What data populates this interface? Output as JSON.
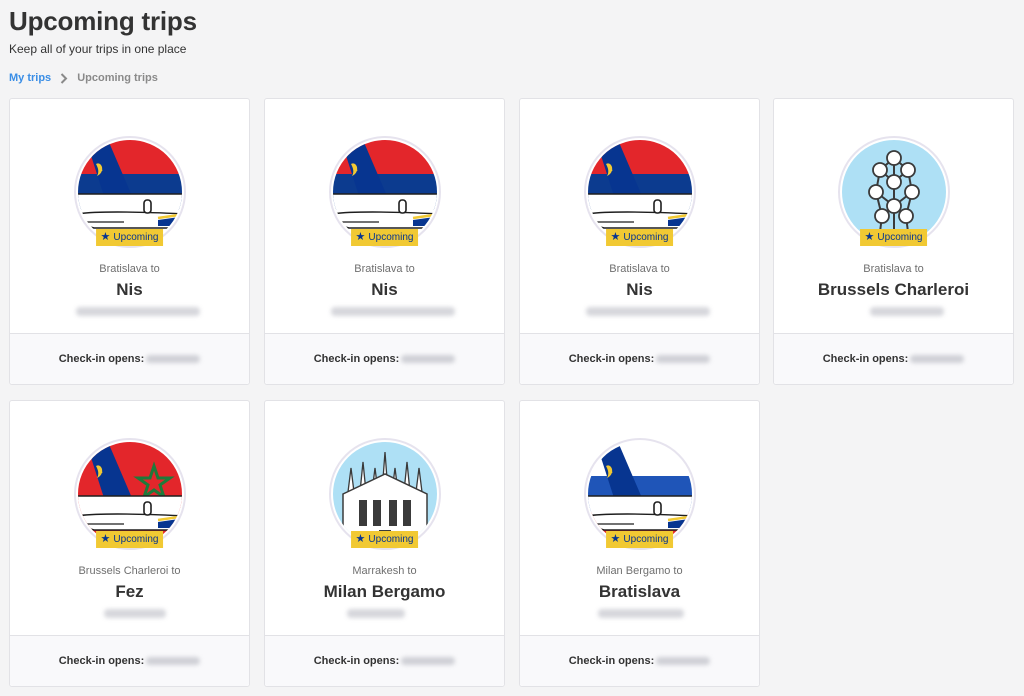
{
  "header": {
    "title": "Upcoming trips",
    "subtitle": "Keep all of your trips in one place"
  },
  "breadcrumb": {
    "parent": "My trips",
    "current": "Upcoming trips"
  },
  "colors": {
    "ryanair_blue": "#073590",
    "ryanair_yellow": "#f1c933",
    "link_blue": "#3a8ee6"
  },
  "status_icon": "star-icon",
  "trips": [
    {
      "origin": "Bratislava to",
      "destination": "Nis",
      "status": "Upcoming",
      "checkin": "Check-in opens:",
      "artwork": "serbia-flag-plane-tail"
    },
    {
      "origin": "Bratislava to",
      "destination": "Nis",
      "status": "Upcoming",
      "checkin": "Check-in opens:",
      "artwork": "serbia-flag-plane-tail"
    },
    {
      "origin": "Bratislava to",
      "destination": "Nis",
      "status": "Upcoming",
      "checkin": "Check-in opens:",
      "artwork": "serbia-flag-plane-tail"
    },
    {
      "origin": "Bratislava to",
      "destination": "Brussels Charleroi",
      "status": "Upcoming",
      "checkin": "Check-in opens:",
      "artwork": "atomium"
    },
    {
      "origin": "Brussels Charleroi to",
      "destination": "Fez",
      "status": "Upcoming",
      "checkin": "Check-in opens:",
      "artwork": "morocco-flag-plane-tail"
    },
    {
      "origin": "Marrakesh to",
      "destination": "Milan Bergamo",
      "status": "Upcoming",
      "checkin": "Check-in opens:",
      "artwork": "milan-cathedral"
    },
    {
      "origin": "Milan Bergamo to",
      "destination": "Bratislava",
      "status": "Upcoming",
      "checkin": "Check-in opens:",
      "artwork": "slovakia-flag-plane-tail"
    }
  ]
}
